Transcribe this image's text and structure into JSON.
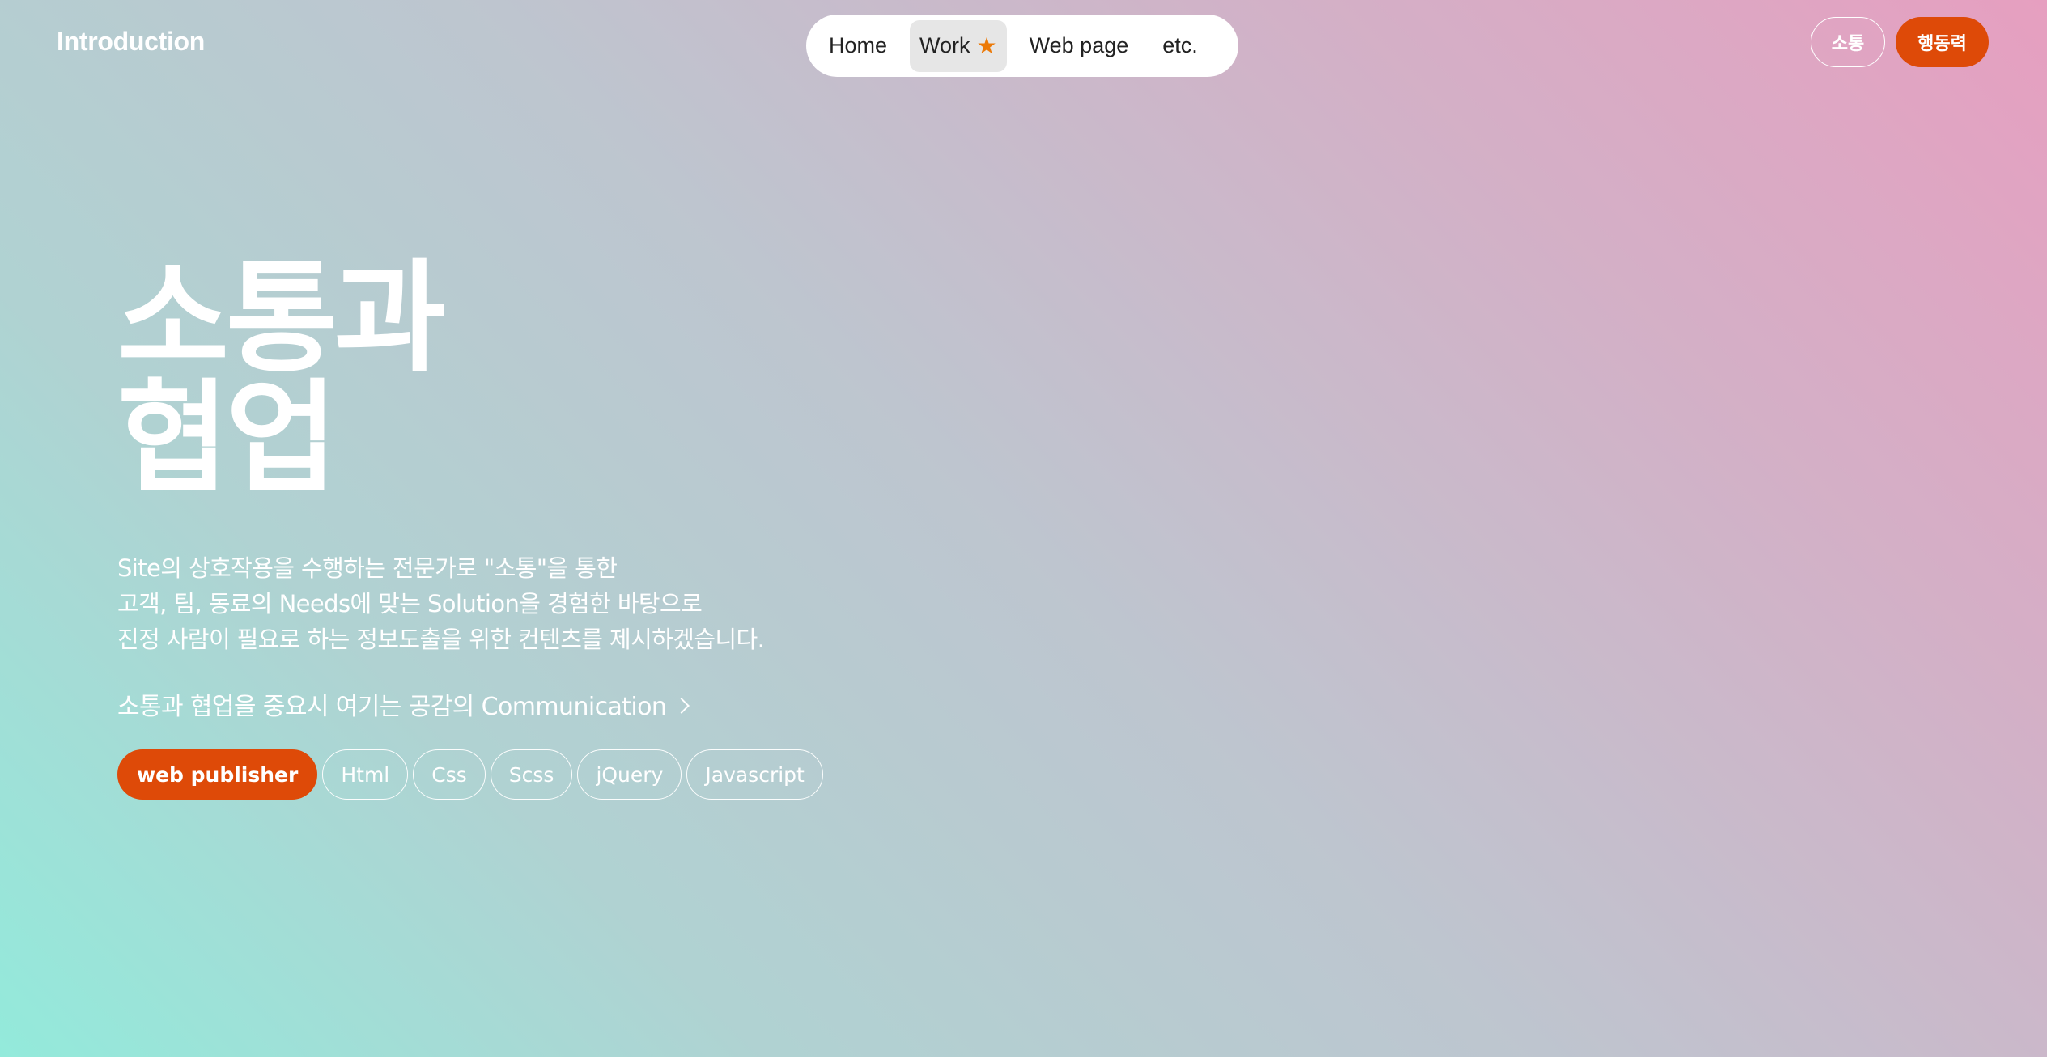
{
  "header": {
    "logo": "Introduction",
    "nav": [
      {
        "label": "Home"
      },
      {
        "label": "Work",
        "icon": "star-icon",
        "active": true
      },
      {
        "label": "Web page"
      },
      {
        "label": "etc."
      }
    ],
    "buttons": {
      "outline_label": "소통",
      "fill_label": "행동력"
    }
  },
  "hero": {
    "title_line1": "소통과",
    "title_line2": "협업",
    "description": [
      "Site의 상호작용을 수행하는 전문가로 \"소통\"을 통한",
      "고객, 팀, 동료의 Needs에 맞는 Solution을 경험한 바탕으로",
      "진정 사람이 필요로 하는 정보도출을 위한 컨텐츠를 제시하겠습니다."
    ],
    "cta_label": "소통과 협업을 중요시 여기는 공감의 Communication",
    "tags": [
      "web publisher",
      "Html",
      "Css",
      "Scss",
      "jQuery",
      "Javascript"
    ]
  },
  "colors": {
    "accent": "#de4a08",
    "star": "#ec7a08",
    "gradient_start": "#93eadb",
    "gradient_end": "#e69fc0"
  }
}
